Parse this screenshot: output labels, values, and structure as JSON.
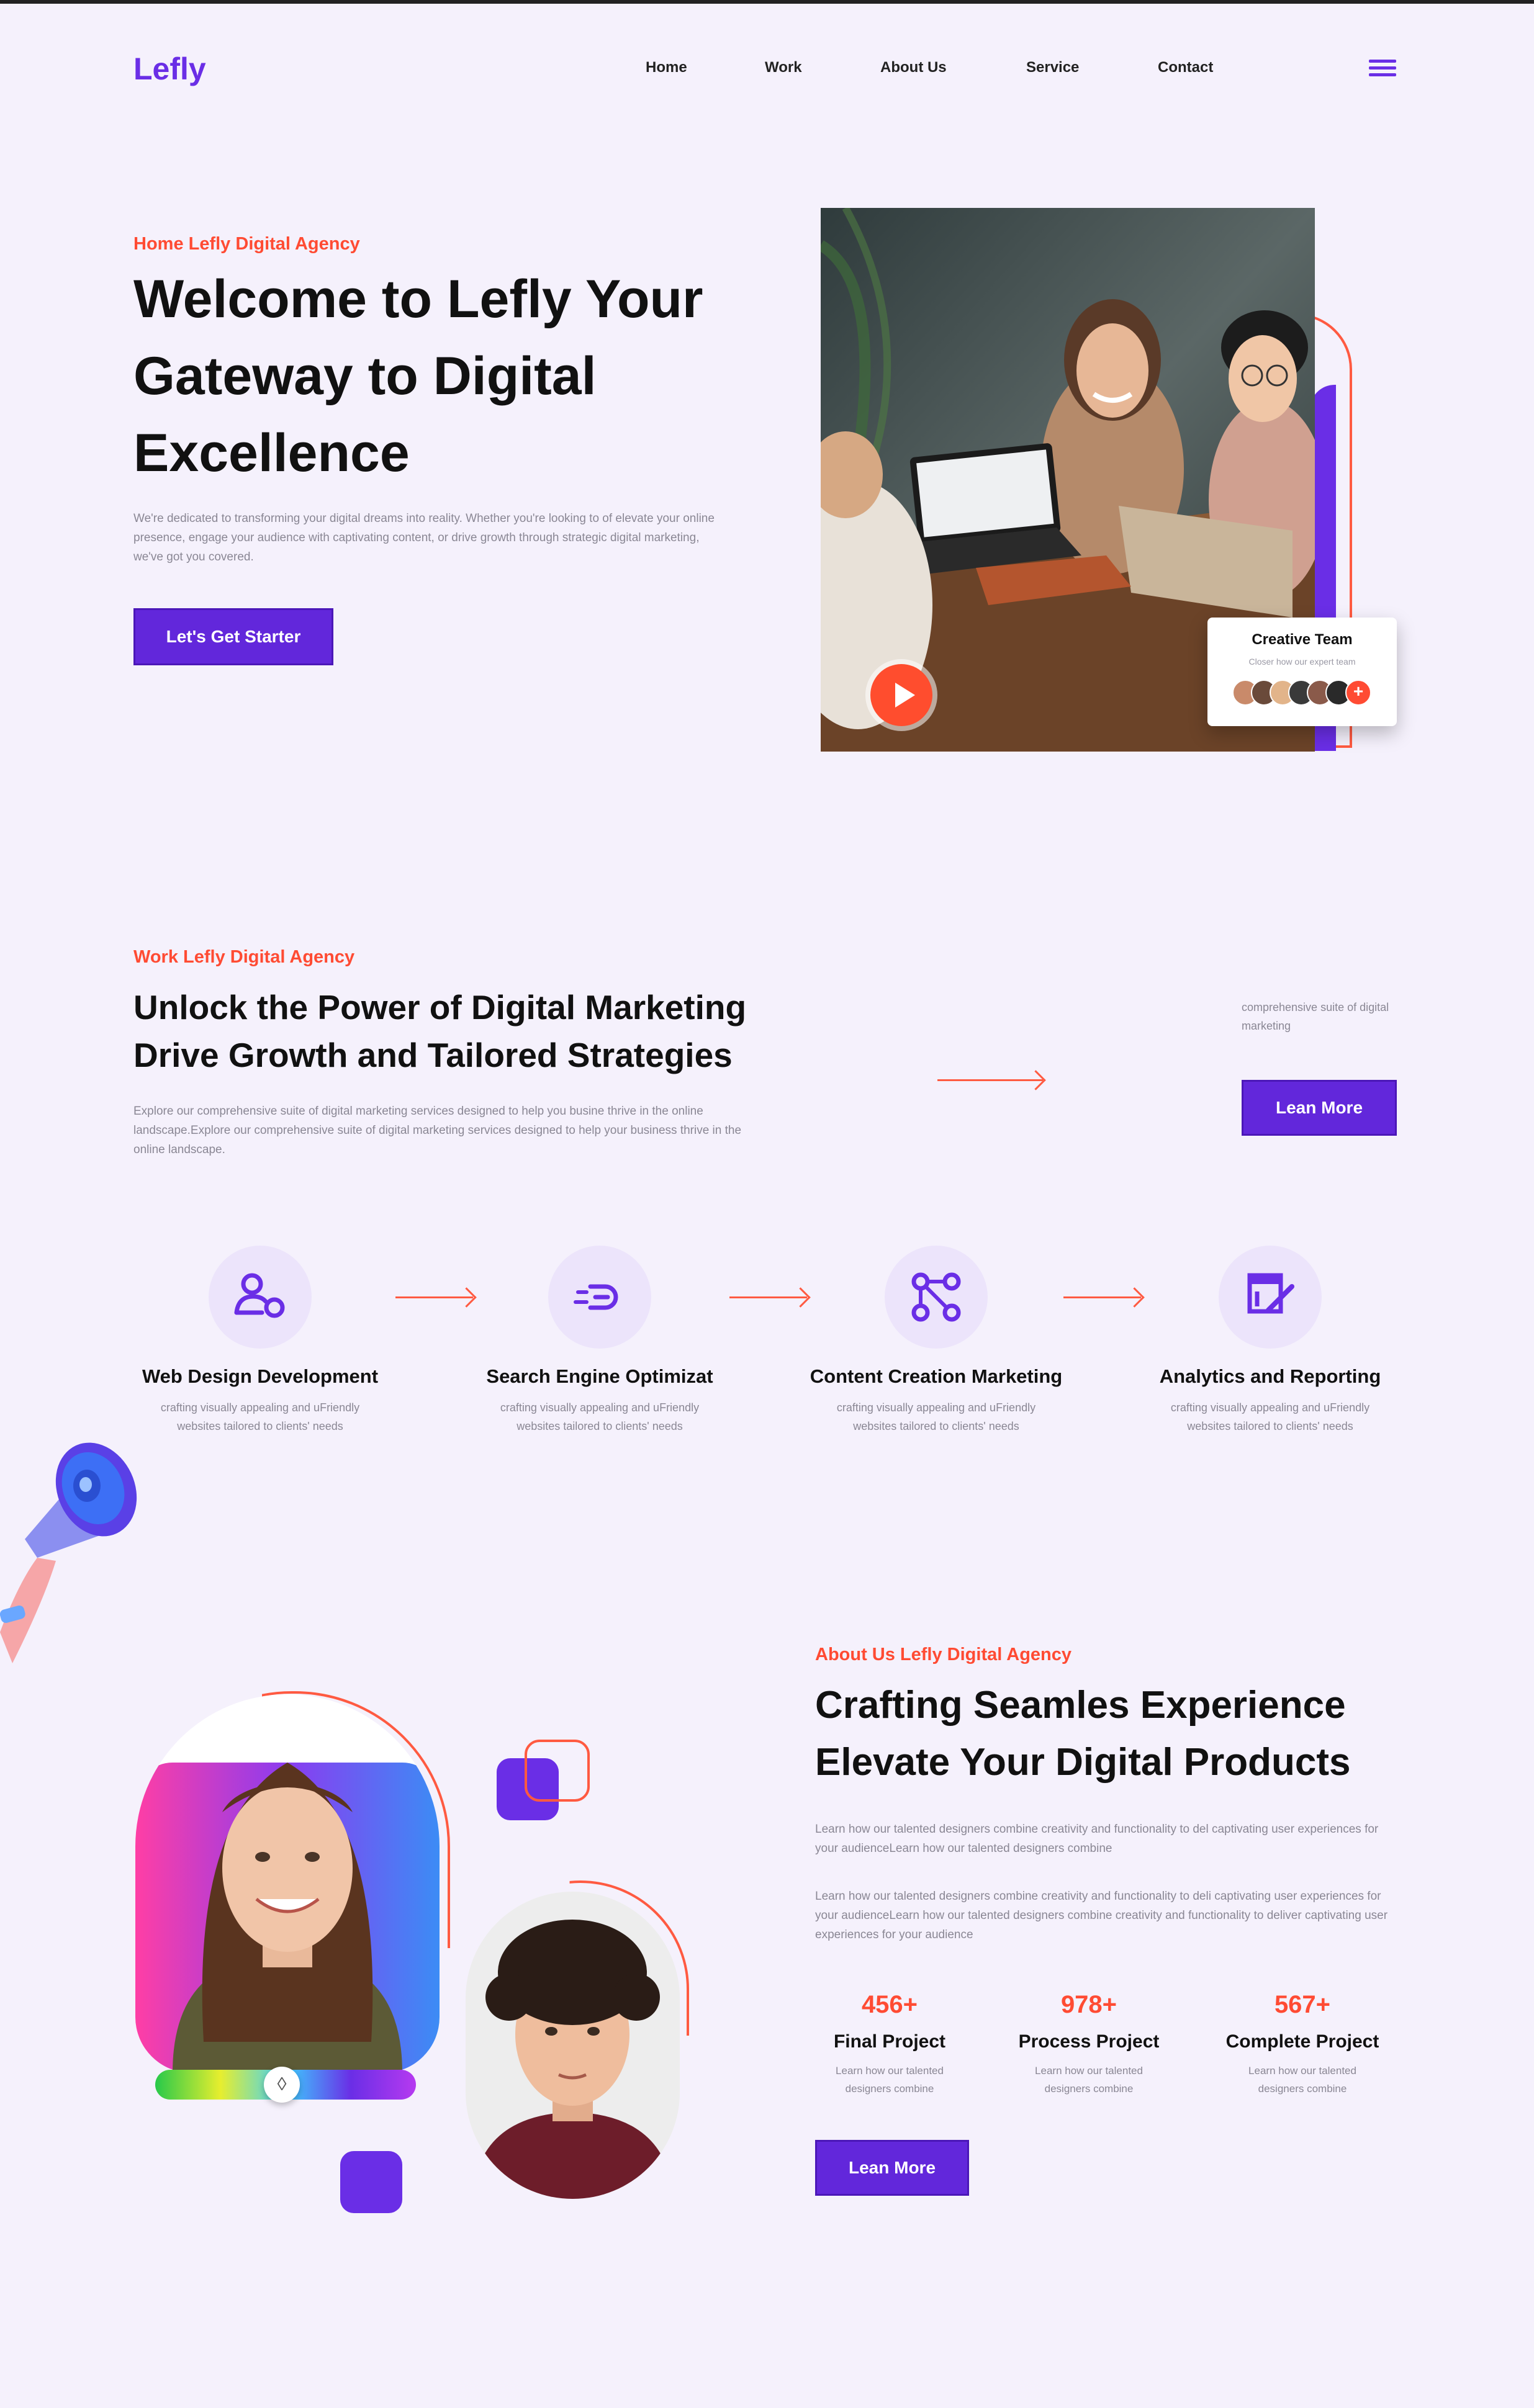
{
  "nav": {
    "logo": "Lefly",
    "items": [
      "Home",
      "Work",
      "About Us",
      "Service",
      "Contact"
    ]
  },
  "hero": {
    "eyebrow": "Home Lefly Digital Agency",
    "title_lines": [
      "Welcome to Lefly Your",
      "Gateway to Digital",
      "Excellence"
    ],
    "description": "We're dedicated to transforming your digital dreams into reality. Whether you're looking to of elevate your online presence, engage your audience with captivating content, or drive growth through strategic digital marketing, we've got you covered.",
    "cta": "Let's Get Starter",
    "team_card": {
      "title": "Creative Team",
      "subtitle": "Closer how our expert team",
      "avatar_colors": [
        "#c98a6a",
        "#6a4a3a",
        "#e2b48a",
        "#3a3a3a",
        "#8a5a4a",
        "#2a2a2a"
      ]
    }
  },
  "work": {
    "eyebrow": "Work Lefly Digital Agency",
    "title_lines": [
      "Unlock the Power of Digital Marketing",
      "Drive Growth and Tailored Strategies"
    ],
    "description": "Explore our comprehensive suite of digital marketing services designed to help you busine thrive in the online landscape.Explore our comprehensive suite of digital marketing services designed to help your business thrive in the online landscape.",
    "side_note": "comprehensive suite of digital marketing",
    "cta": "Lean More"
  },
  "services": [
    {
      "icon": "user-settings-icon",
      "title": "Web Design Development",
      "desc": "crafting visually appealing and uFriendly websites tailored to clients' needs"
    },
    {
      "icon": "search-speed-icon",
      "title": "Search Engine Optimizat",
      "desc": "crafting visually appealing and uFriendly websites tailored to clients' needs"
    },
    {
      "icon": "workflow-nodes-icon",
      "title": "Content Creation Marketing",
      "desc": "crafting visually appealing and uFriendly websites tailored to clients' needs"
    },
    {
      "icon": "analytics-edit-icon",
      "title": "Analytics and Reporting",
      "desc": "crafting visually appealing and uFriendly websites tailored to clients' needs"
    }
  ],
  "about": {
    "eyebrow": "About Us Lefly Digital Agency",
    "title_lines": [
      "Crafting Seamles Experience",
      "Elevate Your Digital Products"
    ],
    "para1": "Learn how our talented designers combine creativity and functionality to del captivating user experiences for your audienceLearn how our talented designers combine",
    "para2": "Learn how our talented designers combine creativity and functionality to deli captivating user experiences for your audienceLearn how our talented designers combine creativity and functionality to deliver captivating user experiences for your audience",
    "stats": [
      {
        "value": "456+",
        "label": "Final Project",
        "desc": "Learn how our talented designers combine"
      },
      {
        "value": "978+",
        "label": "Process Project",
        "desc": "Learn how our talented designers combine"
      },
      {
        "value": "567+",
        "label": "Complete Project",
        "desc": "Learn how our talented designers combine"
      }
    ],
    "cta": "Lean More"
  },
  "colors": {
    "background": "#f5f1fc",
    "brand_purple": "#6227db",
    "accent_orange": "#ff4b33"
  }
}
